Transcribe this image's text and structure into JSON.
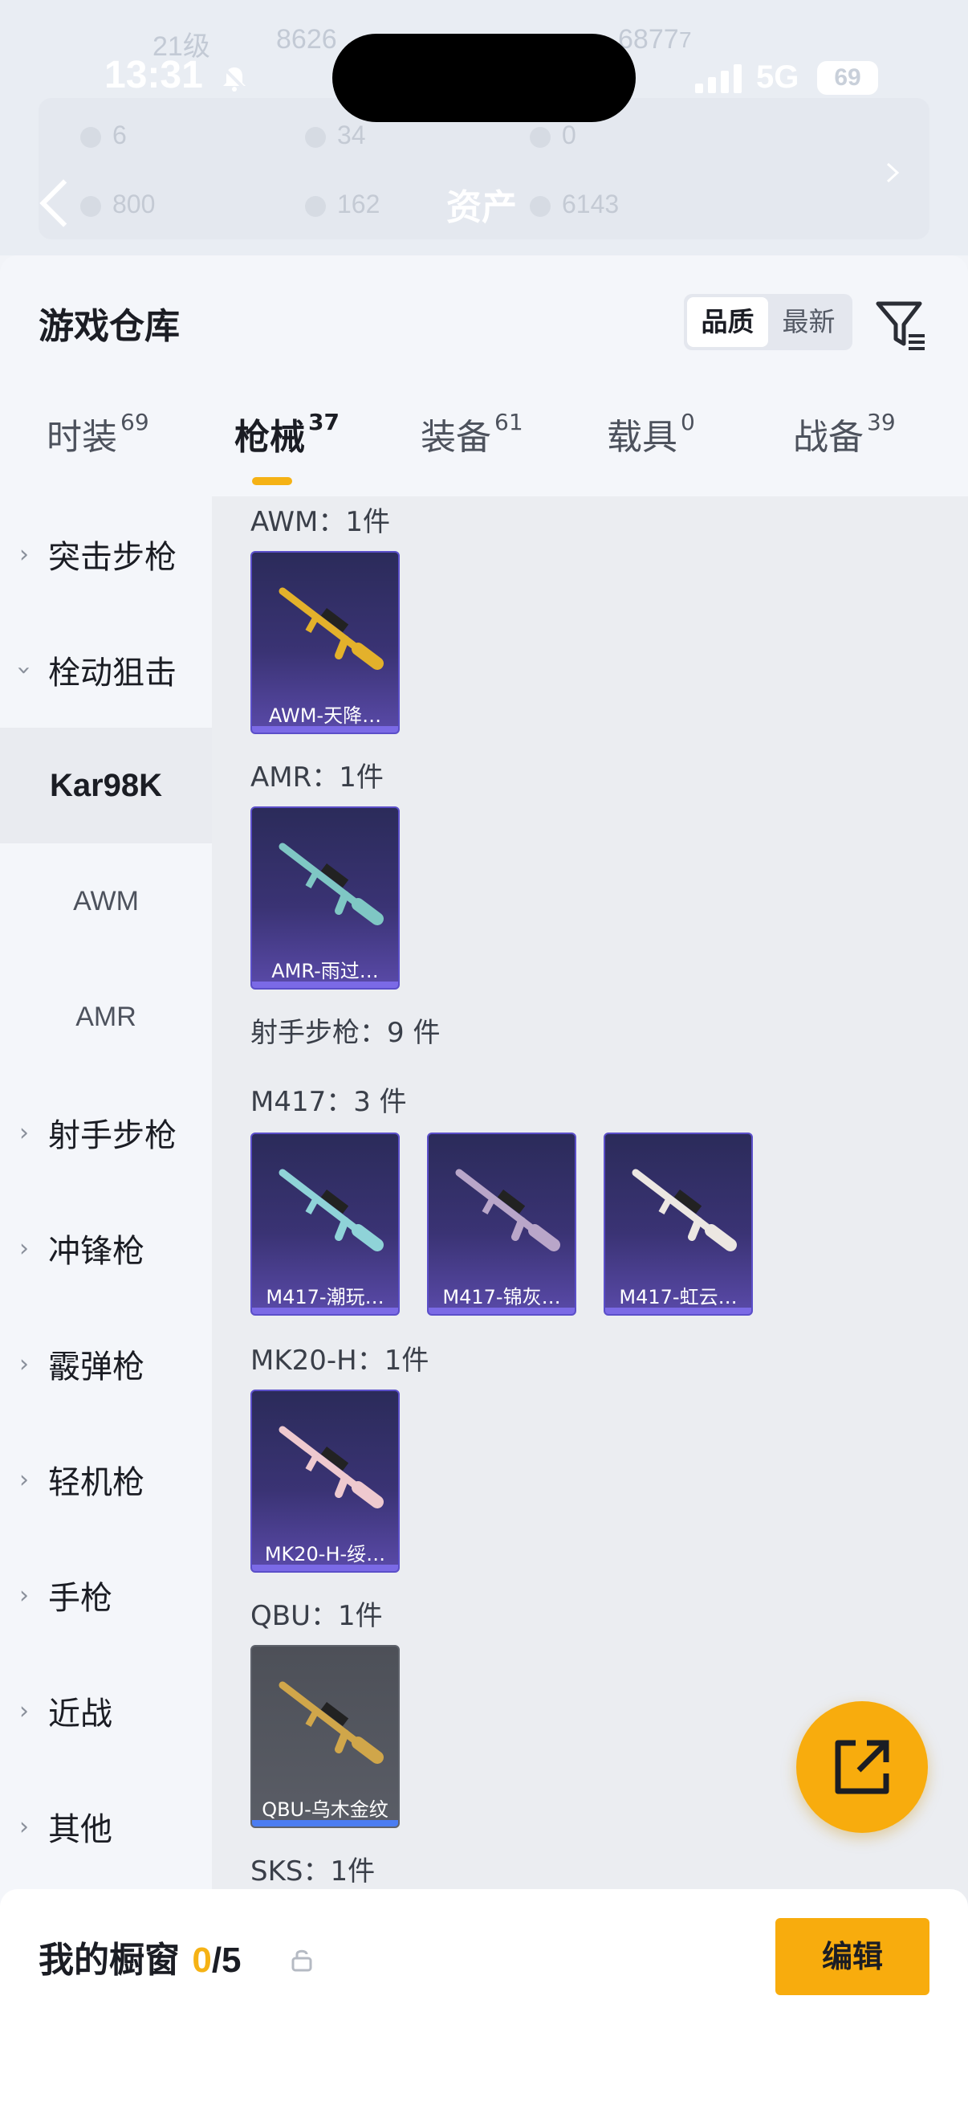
{
  "status_bar": {
    "time": "13:31",
    "network": "5G",
    "battery": "69"
  },
  "header": {
    "title": "资产",
    "ghost": {
      "level": "21级",
      "id_a": "8626",
      "id_b": "6877",
      "suffix": "7",
      "row1": [
        "6",
        "34",
        "0"
      ],
      "row2": [
        "800",
        "162",
        "6143"
      ]
    }
  },
  "sheet": {
    "title": "游戏仓库",
    "sort": {
      "quality": "品质",
      "latest": "最新",
      "selected": "品质"
    }
  },
  "tabs": [
    {
      "label": "时装",
      "count": "69"
    },
    {
      "label": "枪械",
      "count": "37",
      "active": true
    },
    {
      "label": "装备",
      "count": "61"
    },
    {
      "label": "载具",
      "count": "0"
    },
    {
      "label": "战备",
      "count": "39"
    }
  ],
  "sidebar": {
    "items": [
      {
        "label": "突击步枪",
        "chevron": "right"
      },
      {
        "label": "栓动狙击",
        "chevron": "down"
      },
      {
        "label": "Kar98K",
        "selected": true
      },
      {
        "label": "AWM"
      },
      {
        "label": "AMR"
      },
      {
        "label": "射手步枪",
        "chevron": "right"
      },
      {
        "label": "冲锋枪",
        "chevron": "right"
      },
      {
        "label": "霰弹枪",
        "chevron": "right"
      },
      {
        "label": "轻机枪",
        "chevron": "right"
      },
      {
        "label": "手枪",
        "chevron": "right"
      },
      {
        "label": "近战",
        "chevron": "right"
      },
      {
        "label": "其他",
        "chevron": "right"
      }
    ]
  },
  "content": {
    "groups": [
      {
        "label": "AWM：1件"
      },
      {
        "label": "AMR：1件"
      },
      {
        "label": "射手步枪：9 件"
      },
      {
        "label": "M417：3 件"
      },
      {
        "label": "MK20-H：1件"
      },
      {
        "label": "QBU：1件"
      },
      {
        "label": "SKS：1件"
      }
    ],
    "cards": [
      {
        "name": "AWM-天降…",
        "rarity": "purple",
        "gun_color": "#e3b12b"
      },
      {
        "name": "AMR-雨过…",
        "rarity": "purple",
        "gun_color": "#7fc7c4"
      },
      {
        "name": "M417-潮玩…",
        "rarity": "purple",
        "gun_color": "#8fd3d8"
      },
      {
        "name": "M417-锦灰…",
        "rarity": "purple",
        "gun_color": "#b9a6c9"
      },
      {
        "name": "M417-虹云…",
        "rarity": "purple",
        "gun_color": "#ece7e2"
      },
      {
        "name": "MK20-H-绥…",
        "rarity": "purple",
        "gun_color": "#eec9cf"
      },
      {
        "name": "QBU-乌木金纹",
        "rarity": "grey",
        "gun_color": "#d0a64a"
      }
    ]
  },
  "showcase": {
    "title": "我的橱窗",
    "count": "0",
    "total": "/5",
    "edit_label": "编辑"
  },
  "colors": {
    "accent": "#f8ac0d",
    "indicator": "#f5b215",
    "card_purple": "#3a3374",
    "card_grey": "#5a5d66"
  }
}
